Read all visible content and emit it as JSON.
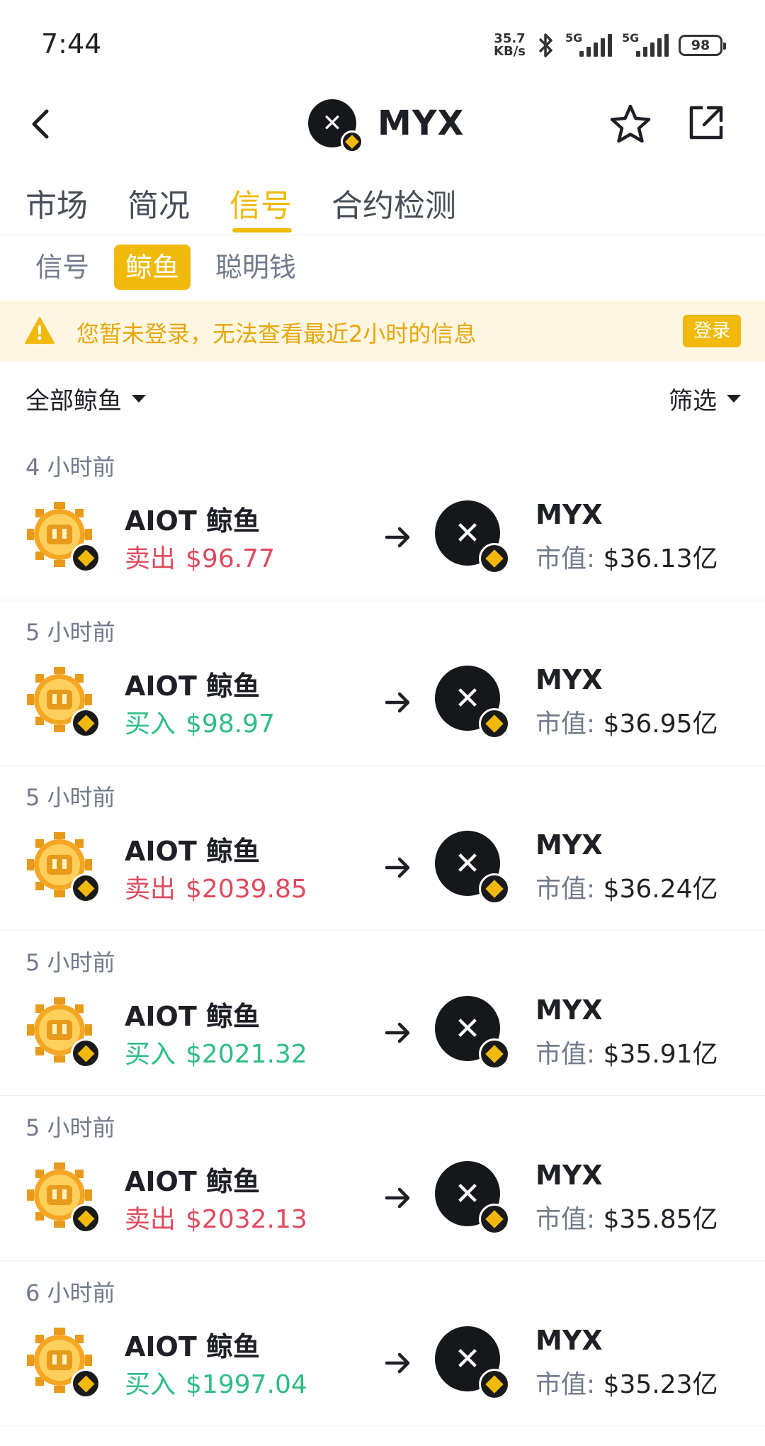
{
  "status_bar": {
    "time": "7:44",
    "net_speed_value": "35.7",
    "net_speed_unit": "KB/s",
    "signal1_label": "5G",
    "signal2_label": "5G",
    "battery": "98"
  },
  "header": {
    "title": "MYX"
  },
  "main_tabs": [
    {
      "label": "市场"
    },
    {
      "label": "简况"
    },
    {
      "label": "信号"
    },
    {
      "label": "合约检测"
    }
  ],
  "sub_tabs": [
    {
      "label": "信号"
    },
    {
      "label": "鲸鱼"
    },
    {
      "label": "聪明钱"
    }
  ],
  "banner": {
    "text": "您暂未登录，无法查看最近2小时的信息",
    "button": "登录"
  },
  "filters": {
    "left": "全部鲸鱼",
    "right": "筛选"
  },
  "signals": [
    {
      "time": "4 小时前",
      "whale": "AIOT 鲸鱼",
      "action": "卖出",
      "side": "sell",
      "amount": "$96.77",
      "token": "MYX",
      "mcap_label": "市值:",
      "mcap": "$36.13亿"
    },
    {
      "time": "5 小时前",
      "whale": "AIOT 鲸鱼",
      "action": "买入",
      "side": "buy",
      "amount": "$98.97",
      "token": "MYX",
      "mcap_label": "市值:",
      "mcap": "$36.95亿"
    },
    {
      "time": "5 小时前",
      "whale": "AIOT 鲸鱼",
      "action": "卖出",
      "side": "sell",
      "amount": "$2039.85",
      "token": "MYX",
      "mcap_label": "市值:",
      "mcap": "$36.24亿"
    },
    {
      "time": "5 小时前",
      "whale": "AIOT 鲸鱼",
      "action": "买入",
      "side": "buy",
      "amount": "$2021.32",
      "token": "MYX",
      "mcap_label": "市值:",
      "mcap": "$35.91亿"
    },
    {
      "time": "5 小时前",
      "whale": "AIOT 鲸鱼",
      "action": "卖出",
      "side": "sell",
      "amount": "$2032.13",
      "token": "MYX",
      "mcap_label": "市值:",
      "mcap": "$35.85亿"
    },
    {
      "time": "6 小时前",
      "whale": "AIOT 鲸鱼",
      "action": "买入",
      "side": "buy",
      "amount": "$1997.04",
      "token": "MYX",
      "mcap_label": "市值:",
      "mcap": "$35.23亿"
    }
  ],
  "colors": {
    "accent": "#f0b90b",
    "sell": "#e04a5e",
    "buy": "#2ebd85"
  }
}
